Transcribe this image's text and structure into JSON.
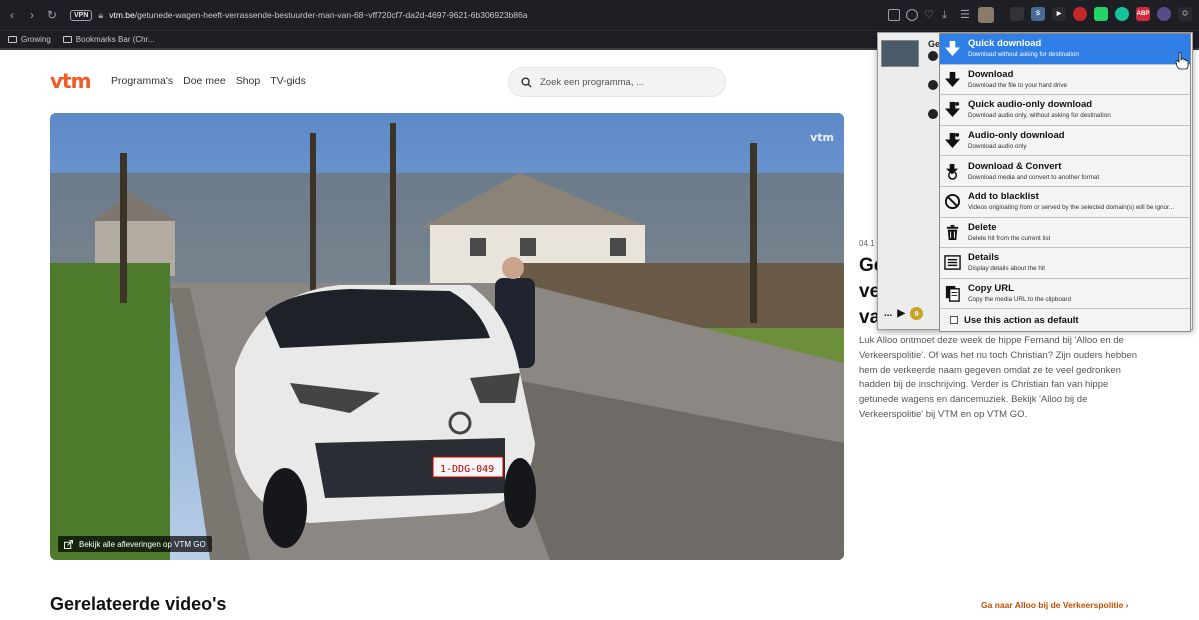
{
  "browser": {
    "vpn_badge": "VPN",
    "url_host": "vtm.be",
    "url_path": "/getunede-wagen-heeft-verrassende-bestuurder-man-van-68~vff720cf7-da2d-4697-9621-6b306923b86a",
    "bookmarks": [
      "Growing",
      "Bookmarks Bar (Chr..."
    ],
    "extension_badge_abp": "ABP"
  },
  "site": {
    "logo": "vtm",
    "nav": [
      "Programma's",
      "Doe mee",
      "Shop",
      "TV-gids"
    ],
    "search_placeholder": "Zoek een programma, ..."
  },
  "video": {
    "watermark": "vtm",
    "episodes_link": "Bekijk alle afleveringen op VTM GO"
  },
  "article": {
    "date": "04.1",
    "title_lines": [
      "Ge",
      "ve",
      "va"
    ],
    "body": "Luk Alloo ontmoet deze week de hippe Fernand bij 'Alloo en de Verkeerspolitie'. Of was het nu toch Christian? Zijn ouders hebben hem de verkeerde naam gegeven omdat ze te veel gedronken hadden bij de inschrijving. Verder is Christian fan van hippe getunede wagens en dancemuziek. Bekijk 'Alloo bij de Verkeerspolitie' bij VTM en op VTM GO."
  },
  "related": {
    "heading": "Gerelateerde video's",
    "link": "Ga naar Alloo bij de Verkeerspolitie"
  },
  "ext_panel": {
    "hit_title": "Ge",
    "more": "...",
    "count": "9"
  },
  "menu": {
    "items": [
      {
        "label": "Quick download",
        "desc": "Download without asking for destination",
        "icon": "download-arrow-icon",
        "active": true
      },
      {
        "label": "Download",
        "desc": "Download the file to your hard drive",
        "icon": "download-arrow-icon"
      },
      {
        "label": "Quick audio-only download",
        "desc": "Download audio only, without asking for destination",
        "icon": "audio-download-icon"
      },
      {
        "label": "Audio-only download",
        "desc": "Download audio only",
        "icon": "audio-download-icon"
      },
      {
        "label": "Download & Convert",
        "desc": "Download media and convert to another format",
        "icon": "convert-icon"
      },
      {
        "label": "Add to blacklist",
        "desc": "Videos originating from or served by the selected domain(s) will be ignor...",
        "icon": "blacklist-icon"
      },
      {
        "label": "Delete",
        "desc": "Delete hit from the current list",
        "icon": "trash-icon"
      },
      {
        "label": "Details",
        "desc": "Display details about the hit",
        "icon": "details-icon"
      },
      {
        "label": "Copy URL",
        "desc": "Copy the media URL to the clipboard",
        "icon": "copy-icon"
      }
    ],
    "default_label": "Use this action as default"
  },
  "colors": {
    "brand_orange": "#f15a22",
    "menu_active": "#2f7fe6",
    "link_orange": "#c24e00"
  }
}
